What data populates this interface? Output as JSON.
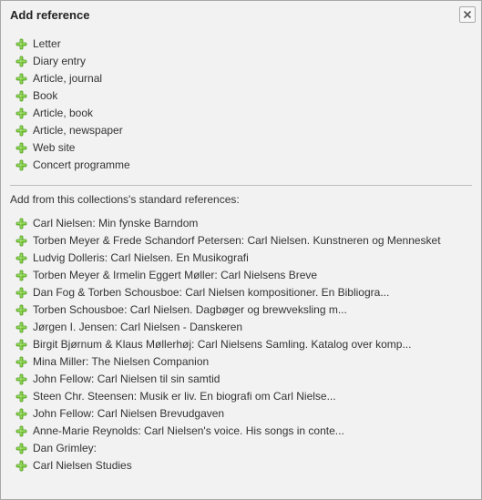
{
  "dialog": {
    "title": "Add reference"
  },
  "reference_types": [
    "Letter",
    "Diary entry",
    "Article, journal",
    "Book",
    "Article, book",
    "Article, newspaper",
    "Web site",
    "Concert programme"
  ],
  "standard_section_label": "Add from this collections's standard references:",
  "standard_references": [
    "Carl Nielsen: Min fynske Barndom",
    "Torben Meyer & Frede Schandorf Petersen: Carl Nielsen. Kunstneren og Mennesket",
    "Ludvig Dolleris: Carl Nielsen. En Musikografi",
    "Torben Meyer & Irmelin Eggert Møller: Carl Nielsens Breve",
    "Dan Fog & Torben Schousboe: Carl Nielsen kompositioner. En Bibliogra...",
    "Torben Schousboe: Carl Nielsen. Dagbøger og brewveksling m...",
    "Jørgen I. Jensen: Carl Nielsen - Danskeren",
    "Birgit Bjørnum & Klaus Møllerhøj: Carl Nielsens Samling. Katalog over komp...",
    "Mina Miller: The Nielsen Companion",
    "John Fellow: Carl Nielsen til sin samtid",
    "Steen Chr. Steensen: Musik er liv. En biografi om Carl Nielse...",
    "John Fellow: Carl Nielsen Brevudgaven",
    "Anne-Marie Reynolds: Carl Nielsen's voice. His songs in conte...",
    "Dan Grimley:",
    "Carl Nielsen Studies"
  ]
}
